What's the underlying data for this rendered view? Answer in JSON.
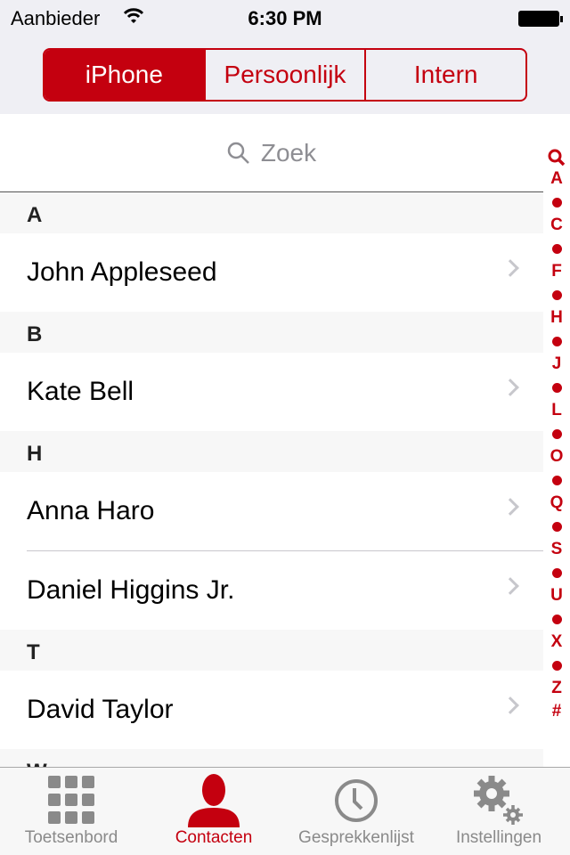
{
  "status": {
    "carrier": "Aanbieder",
    "time": "6:30 PM"
  },
  "segments": [
    {
      "label": "iPhone",
      "selected": true
    },
    {
      "label": "Persoonlijk"
    },
    {
      "label": "Intern"
    }
  ],
  "search": {
    "placeholder": "Zoek"
  },
  "sections": [
    {
      "letter": "A",
      "contacts": [
        "John Appleseed"
      ]
    },
    {
      "letter": "B",
      "contacts": [
        "Kate Bell"
      ]
    },
    {
      "letter": "H",
      "contacts": [
        "Anna Haro",
        "Daniel Higgins Jr."
      ]
    },
    {
      "letter": "T",
      "contacts": [
        "David Taylor"
      ]
    },
    {
      "letter": "W",
      "contacts": []
    }
  ],
  "index": [
    "A",
    "•",
    "C",
    "•",
    "F",
    "•",
    "H",
    "•",
    "J",
    "•",
    "L",
    "•",
    "O",
    "•",
    "Q",
    "•",
    "S",
    "•",
    "U",
    "•",
    "X",
    "•",
    "Z",
    "#"
  ],
  "tabs": [
    {
      "label": "Toetsenbord",
      "icon": "keypad-icon"
    },
    {
      "label": "Contacten",
      "icon": "person-icon",
      "active": true
    },
    {
      "label": "Gesprekkenlijst",
      "icon": "clock-icon"
    },
    {
      "label": "Instellingen",
      "icon": "gears-icon"
    }
  ],
  "colors": {
    "accent": "#c4000f"
  }
}
